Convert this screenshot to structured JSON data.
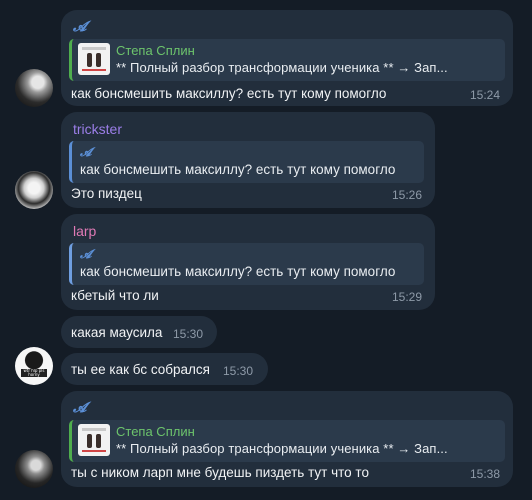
{
  "colors": {
    "background": "#141c26",
    "bubble": "#222e3c",
    "quote_bg": "#2b3a4b",
    "green_author": "#6dc46c",
    "blue_accent": "#5b8fd6",
    "sender_trickster": "#9b7ee8",
    "sender_larp": "#e07ab6",
    "time": "#8e9aa8"
  },
  "messages": [
    {
      "sender_icon": "𝓐",
      "quote_author": "Степа Сплин",
      "quote_text": "**    Полный разбор трансформации ученика    **    → Зап...",
      "text": "как бонсмешить максиллу?  есть тут кому помогло",
      "time": "15:24"
    },
    {
      "sender": "trickster",
      "quote_icon": "𝓐",
      "quote_text": "как бонсмешить максиллу?  есть тут кому помогло",
      "text": "Это пиздец",
      "time": "15:26"
    },
    {
      "sender": "larp",
      "quote_icon": "𝓐",
      "quote_text": "как бонсмешить максиллу?  есть тут кому помогло",
      "text": "кбетый что ли",
      "time": "15:29"
    },
    {
      "text": "какая маусила",
      "time": "15:30"
    },
    {
      "text": "ты ее как бс собрался",
      "time": "15:30"
    },
    {
      "sender_icon": "𝓐",
      "quote_author": "Степа Сплин",
      "quote_text": "**    Полный разбор трансформации ученика    **    → Зап...",
      "text": "ты с ником ларп мне будешь пиздеть тут что то",
      "time": "15:38"
    }
  ],
  "avatars": {
    "avatar3_caption": "wtr hlp pls horny"
  }
}
